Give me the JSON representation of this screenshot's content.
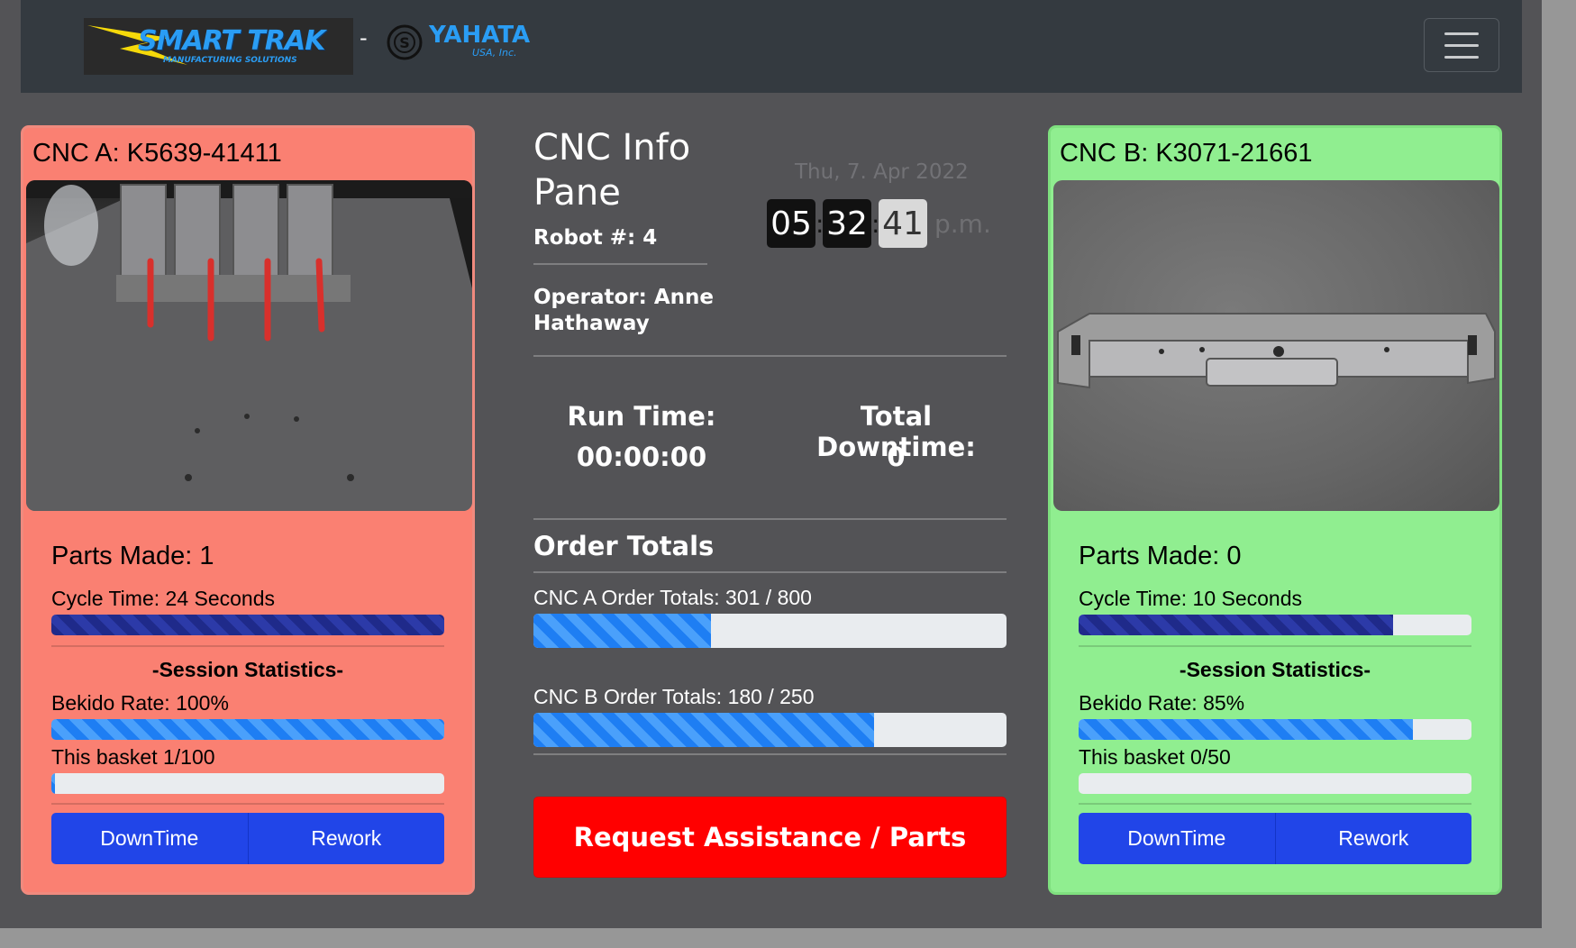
{
  "header": {
    "logo_primary": "SMART TRAK",
    "logo_primary_sub": "MANUFACTURING SOLUTIONS",
    "separator": "-",
    "logo_secondary": "YAHATA",
    "logo_secondary_sub": "USA, Inc.",
    "menu_icon": "hamburger-menu-icon"
  },
  "cnc_a": {
    "title": "CNC A: K5639-41411",
    "status_color": "#fa8072",
    "parts_made": "Parts Made: 1",
    "cycle_time": "Cycle Time: 24 Seconds",
    "cycle_progress": 1.0,
    "session_heading": "-Session Statistics-",
    "bekido_rate": "Bekido Rate: 100%",
    "bekido_progress": 1.0,
    "basket": "This basket 1/100",
    "basket_progress": 0.01,
    "downtime_label": "DownTime",
    "rework_label": "Rework"
  },
  "cnc_b": {
    "title": "CNC B: K3071-21661",
    "status_color": "#90ee90",
    "parts_made": "Parts Made: 0",
    "cycle_time": "Cycle Time: 10 Seconds",
    "cycle_progress": 0.8,
    "session_heading": "-Session Statistics-",
    "bekido_rate": "Bekido Rate: 85%",
    "bekido_progress": 0.85,
    "basket": "This basket 0/50",
    "basket_progress": 0.0,
    "downtime_label": "DownTime",
    "rework_label": "Rework"
  },
  "info": {
    "title": "CNC Info Pane",
    "robot": "Robot #: 4",
    "operator": "Operator: Anne Hathaway",
    "date": "Thu, 7. Apr 2022",
    "clock": {
      "hours": "05",
      "minutes": "32",
      "seconds": "41",
      "ampm": "p.m."
    },
    "run_time_label": "Run Time:",
    "run_time_value": "00:00:00",
    "downtime_label": "Total Downtime:",
    "downtime_value": "0",
    "order_totals_heading": "Order Totals",
    "cnc_a_order": "CNC A Order Totals: 301 / 800",
    "cnc_a_order_progress": 0.376,
    "cnc_b_order": "CNC B Order Totals: 180 / 250",
    "cnc_b_order_progress": 0.72,
    "request_button": "Request Assistance / Parts"
  },
  "colors": {
    "accent_blue": "#2145e8",
    "alert_red": "#ff0000",
    "progress_navy": "#1f2a8a",
    "progress_blue": "#1e7ef3"
  }
}
